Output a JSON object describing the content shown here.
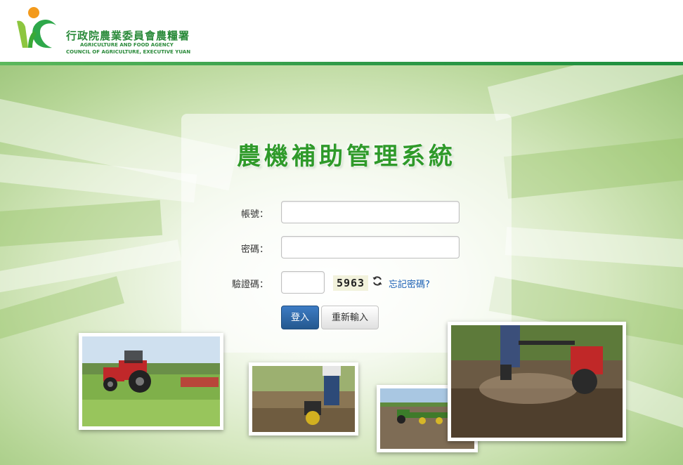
{
  "header": {
    "org_name_zh": "行政院農業委員會農糧署",
    "org_name_en_line1": "AGRICULTURE AND FOOD AGENCY",
    "org_name_en_line2": "COUNCIL OF AGRICULTURE, EXECUTIVE YUAN"
  },
  "login": {
    "title": "農機補助管理系統",
    "account_label": "帳號：",
    "account_value": "",
    "password_label": "密碼：",
    "password_value": "",
    "captcha_label": "驗證碼：",
    "captcha_value": "",
    "captcha_code": "5963",
    "forgot_link": "忘記密碼?",
    "login_button": "登入",
    "reset_button": "重新輸入"
  },
  "colors": {
    "brand_green": "#2f9a2a",
    "header_line": "#2f9a48",
    "primary_button": "#24588f",
    "link": "#1a5fb4"
  },
  "icons": {
    "refresh": "refresh-icon"
  }
}
